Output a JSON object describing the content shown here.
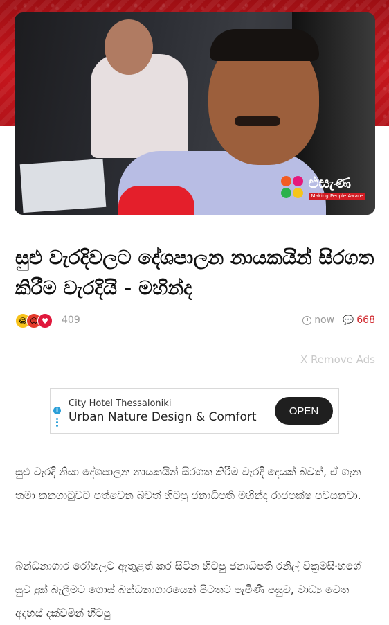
{
  "hero": {
    "logo_name": "එසැණ",
    "logo_tagline": "Making People Aware"
  },
  "article": {
    "title": "සුළු වැරදිවලට දේශපාලන නායකයින් සිරගත කිරීම වැරදියි - මහින්ද",
    "reaction_count": "409",
    "time": "now",
    "comment_count": "668",
    "paragraphs": [
      "සුළු වැරදි නිසා දේශපාලන නායකයින් සිරගත කිරීම වැරදි දෙයක් බවත්, ඒ ගැන තමා කනගාටුවට පත්වෙන බවත් හිටපු ජනාධිපති මහින්ද රාජපක්ෂ පවසනවා.",
      "බන්ධනාගාර රෝහලට ඇතුළත් කර සිටින හිටපු ජනාධිපති රනිල් වික්‍රමසිංහගේ සුව දුක් බැලීමට ගොස් බන්ධනාගාරයෙන් පිටතට පැමිණි පසුව, මාධ්‍ය වෙත අදහස් දක්වමින් හිටපු"
    ]
  },
  "ads": {
    "remove_label": "X Remove Ads",
    "sponsor": "City Hotel Thessaloniki",
    "headline": "Urban Nature Design & Comfort",
    "cta": "OPEN",
    "info_glyph": "i"
  },
  "icons": {
    "reaction_1": "😂",
    "reaction_2": "😡",
    "reaction_3": "♥",
    "comment": "💬"
  },
  "colors": {
    "brand_red": "#c7161d",
    "comment_red": "#d0262c",
    "ad_button": "#1f1f1f"
  }
}
